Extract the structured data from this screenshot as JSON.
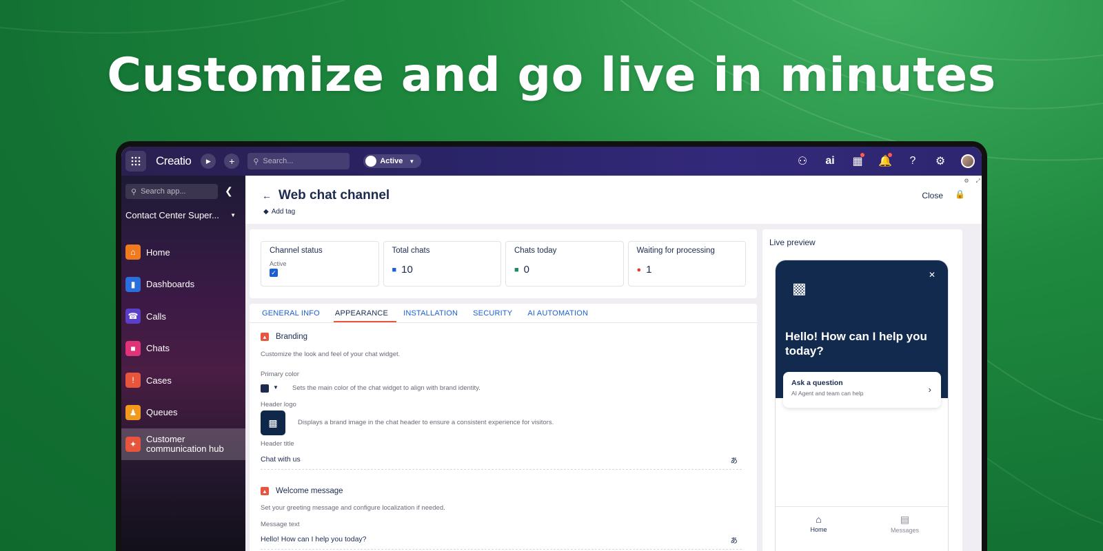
{
  "headline": "Customize and go live in minutes",
  "topbar": {
    "logo": "Creatio",
    "search_placeholder": "Search...",
    "status_label": "Active"
  },
  "sidebar": {
    "search_placeholder": "Search app...",
    "workspace": "Contact Center Super...",
    "items": [
      {
        "label": "Home",
        "color": "#f07a1e",
        "icon": "home-icon"
      },
      {
        "label": "Dashboards",
        "color": "#2a6fdc",
        "icon": "chart-icon"
      },
      {
        "label": "Calls",
        "color": "#5b3fc9",
        "icon": "phone-icon"
      },
      {
        "label": "Chats",
        "color": "#e0347a",
        "icon": "chat-icon"
      },
      {
        "label": "Cases",
        "color": "#e8553d",
        "icon": "case-icon"
      },
      {
        "label": "Queues",
        "color": "#f29a1e",
        "icon": "queue-icon"
      },
      {
        "label": "Customer communication hub",
        "color": "#e8553d",
        "icon": "hub-icon"
      }
    ]
  },
  "page": {
    "title": "Web chat channel",
    "add_tag": "Add tag",
    "close": "Close"
  },
  "metrics": [
    {
      "label": "Channel status",
      "sub": "Active"
    },
    {
      "label": "Total chats",
      "value": "10",
      "color": "#1b5fd2"
    },
    {
      "label": "Chats today",
      "value": "0",
      "color": "#1a8a6a"
    },
    {
      "label": "Waiting for processing",
      "value": "1",
      "color": "#e03b3b"
    }
  ],
  "tabs": [
    "GENERAL INFO",
    "APPEARANCE",
    "INSTALLATION",
    "SECURITY",
    "AI AUTOMATION"
  ],
  "active_tab": "APPEARANCE",
  "branding": {
    "title": "Branding",
    "desc": "Customize the look and feel of your chat widget.",
    "primary_color_label": "Primary color",
    "primary_color_desc": "Sets the main color of the chat widget to align with brand identity.",
    "header_logo_label": "Header logo",
    "header_logo_desc": "Displays a brand image in the chat header to ensure a consistent experience for visitors.",
    "header_title_label": "Header title",
    "header_title_value": "Chat with us"
  },
  "welcome": {
    "title": "Welcome message",
    "desc": "Set your greeting message and configure localization if needed.",
    "message_label": "Message text",
    "message_value": "Hello! How can I help you today?"
  },
  "preview": {
    "title": "Live preview",
    "hello": "Hello! How can I help you today?",
    "ask_title": "Ask a question",
    "ask_sub": "AI Agent and team can help",
    "nav_home": "Home",
    "nav_messages": "Messages"
  }
}
